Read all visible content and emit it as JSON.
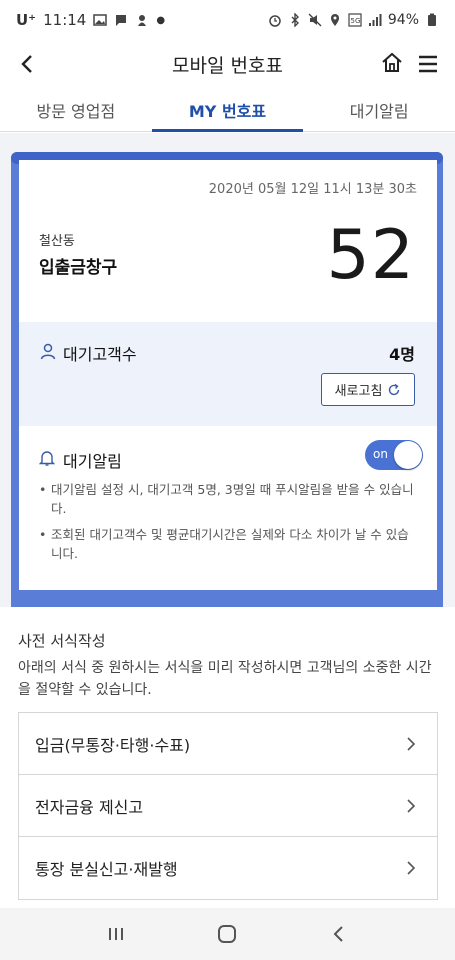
{
  "status_bar": {
    "carrier": "U⁺",
    "time": "11:14",
    "battery": "94%"
  },
  "header": {
    "title": "모바일 번호표"
  },
  "tabs": [
    {
      "label": "방문 영업점",
      "active": false
    },
    {
      "label": "MY 번호표",
      "active": true
    },
    {
      "label": "대기알림",
      "active": false
    }
  ],
  "ticket": {
    "datetime": "2020년 05월 12일 11시 13분 30초",
    "branch": "철산동",
    "window": "입출금창구",
    "number": "52",
    "waiting_label": "대기고객수",
    "waiting_count": "4명",
    "refresh_label": "새로고침",
    "alarm_label": "대기알림",
    "alarm_toggle": "on",
    "notes": [
      "대기알림 설정 시, 대기고객 5명, 3명일 때 푸시알림을 받을 수 있습니다.",
      "조회된 대기고객수 및 평균대기시간은 실제와 다소 차이가 날 수 있습니다."
    ]
  },
  "preform": {
    "title": "사전 서식작성",
    "description": "아래의 서식 중 원하시는 서식을 미리 작성하시면 고객님의 소중한 시간을 절약할 수 있습니다.",
    "items": [
      {
        "label": "입금(무통장·타행·수표)"
      },
      {
        "label": "전자금융 제신고"
      },
      {
        "label": "통장 분실신고·재발행"
      }
    ]
  },
  "colors": {
    "accent": "#1f4fa8",
    "ticket_frame": "#5a7ed8",
    "toggle_on": "#4a72d4"
  }
}
